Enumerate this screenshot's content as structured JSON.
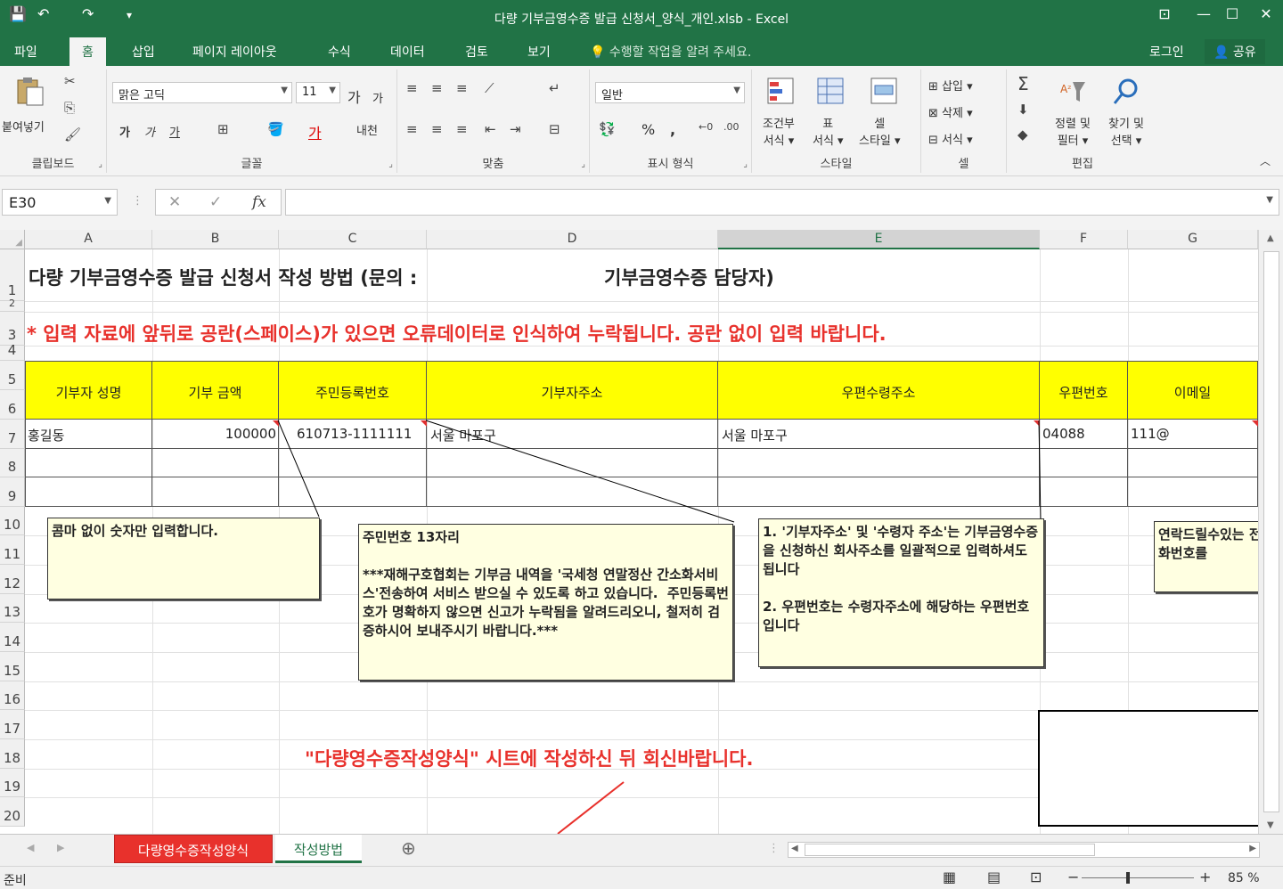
{
  "window": {
    "title": "다량 기부금영수증 발급 신청서_양식_개인.xlsb - Excel"
  },
  "tabs": [
    "파일",
    "홈",
    "삽입",
    "페이지 레이아웃",
    "수식",
    "데이터",
    "검토",
    "보기"
  ],
  "tell_me": "수행할 작업을 알려 주세요.",
  "login": "로그인",
  "share": "공유",
  "ribbon": {
    "clipboard": {
      "label": "클립보드",
      "paste": "붙여넣기"
    },
    "font": {
      "label": "글꼴",
      "font_name": "맑은 고딕",
      "font_size": "11",
      "bold": "가",
      "italic": "가",
      "underline": "가",
      "inc": "가",
      "dec": "가",
      "phonetic": "내천"
    },
    "align": {
      "label": "맞춤"
    },
    "number": {
      "label": "표시 형식",
      "format": "일반",
      "percent": "%",
      "comma": ","
    },
    "styles": {
      "label": "스타일",
      "cond": "조건부\n서식 ▾",
      "table": "표\n서식 ▾",
      "cell": "셀\n스타일 ▾"
    },
    "cells": {
      "label": "셀",
      "insert": "삽입",
      "delete": "삭제",
      "format": "서식"
    },
    "editing": {
      "label": "편집",
      "sort": "정렬 및\n필터 ▾",
      "find": "찾기 및\n선택 ▾"
    }
  },
  "formula_bar": {
    "name_box": "E30",
    "formula": ""
  },
  "columns": [
    "A",
    "B",
    "C",
    "D",
    "E",
    "F",
    "G"
  ],
  "rows": [
    "1",
    "2",
    "3",
    "4",
    "5",
    "6",
    "7",
    "8",
    "9",
    "10",
    "11",
    "12",
    "13",
    "14",
    "15",
    "16",
    "17",
    "18",
    "19",
    "20"
  ],
  "sheet": {
    "title": "다량 기부금영수증 발급 신청서 작성 방법 (문의 :",
    "title_contact": "기부금영수증 담당자)",
    "warning": "* 입력 자료에 앞뒤로 공란(스페이스)가 있으면 오류데이터로 인식하여 누락됩니다. 공란 없이 입력 바랍니다.",
    "headers": [
      "기부자 성명",
      "기부 금액",
      "주민등록번호",
      "기부자주소",
      "우편수령주소",
      "우편번호",
      "이메일"
    ],
    "row7": {
      "name": "홍길동",
      "amount": "100000",
      "rrn": "610713-1111111",
      "addr": "서울 마포구",
      "mail_addr": "서울 마포구",
      "zip": "04088",
      "email": "111@"
    },
    "reply_note": "\"다량영수증작성양식\" 시트에 작성하신 뒤 회신바랍니다."
  },
  "comments": {
    "amount": "콤마 없이 숫자만 입력합니다.",
    "rrn": "주민번호 13자리\n\n***재해구호협회는 기부금 내역을 '국세청 연말정산 간소화서비스'전송하여 서비스 받으실 수 있도록 하고 있습니다.  주민등록번호가 명확하지 않으면 신고가 누락됨을 알려드리오니, 철저히 검증하시어 보내주시기 바랍니다.***",
    "address": "1. '기부자주소' 및 '수령자 주소'는 기부금영수증을 신청하신 회사주소를 일괄적으로 입력하셔도 됩니다\n\n2. 우편번호는 수령자주소에 해당하는 우편번호입니다",
    "email": "연락드릴수있는 전화번호를"
  },
  "sheet_tabs": [
    "다량영수증작성양식",
    "작성방법"
  ],
  "status": {
    "ready": "준비",
    "zoom": "85 %"
  },
  "colors": {
    "accent": "#217346",
    "header_fill": "#ffff00",
    "warning_red": "#e8312c"
  }
}
